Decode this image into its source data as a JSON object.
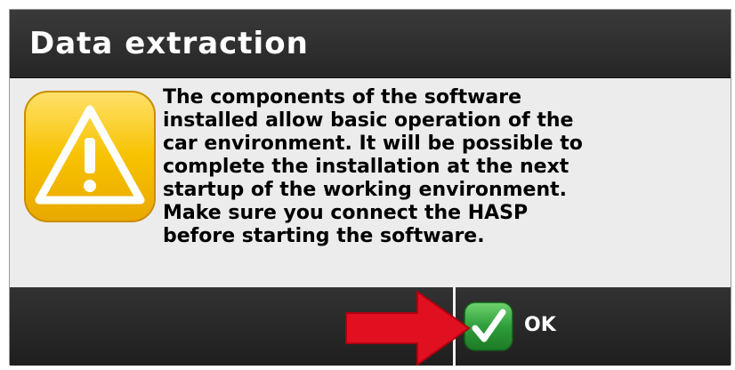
{
  "dialog": {
    "title": "Data extraction",
    "message": "The components of the software\ninstalled allow basic operation of the\ncar environment. It will be possible to\ncomplete the installation at the next\nstartup of the working environment.\nMake sure you connect the HASP\nbefore starting the software.",
    "icon": "warning-icon",
    "ok_label": "OK",
    "ok_icon": "checkmark-icon"
  },
  "colors": {
    "titlebar": "#2e2e2e",
    "footer": "#262626",
    "warning": "#f5b800",
    "ok_green": "#2e9e3a",
    "arrow": "#e01020"
  }
}
